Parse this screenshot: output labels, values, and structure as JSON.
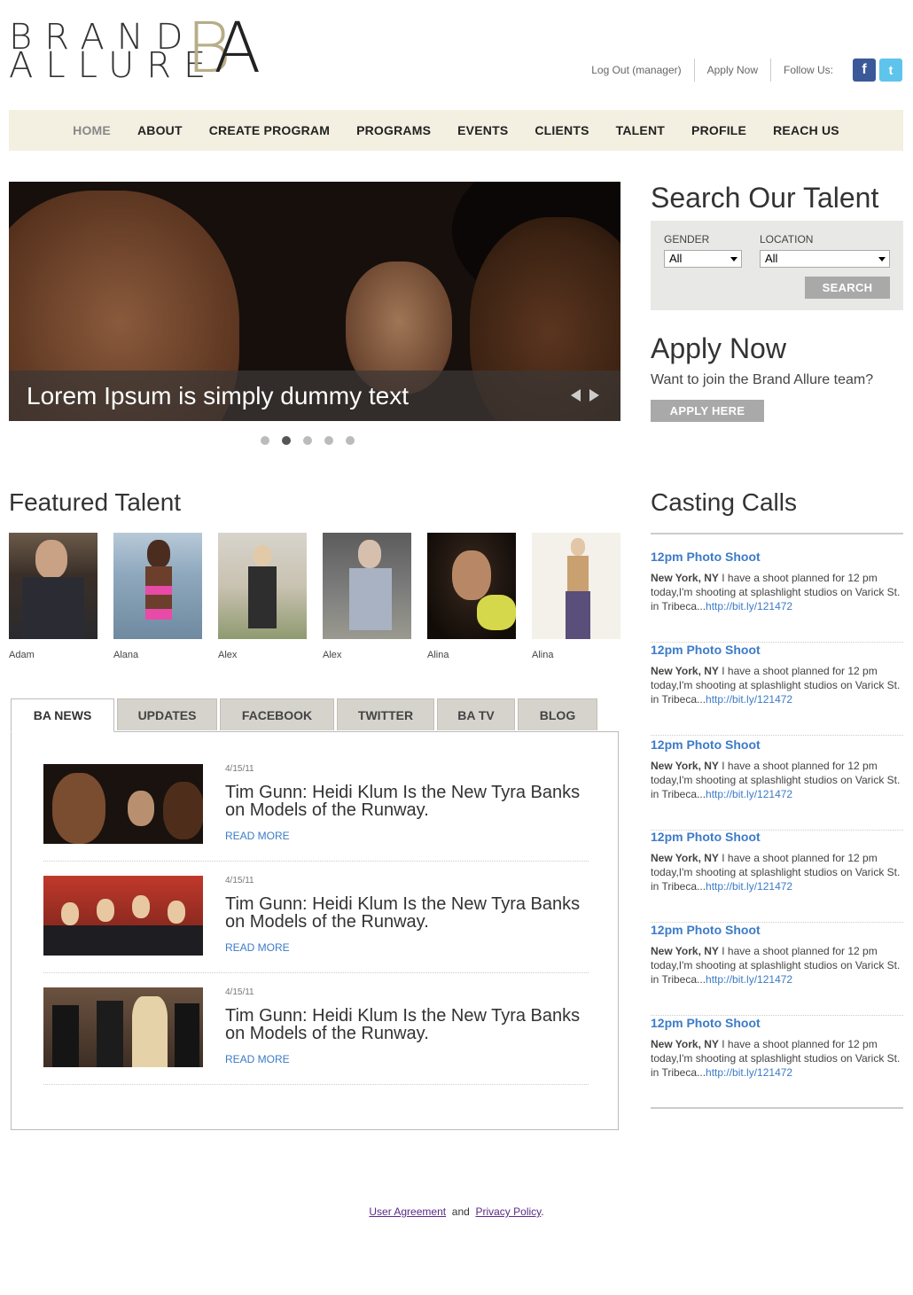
{
  "brand": {
    "line1": "BRAND",
    "line2": "ALLURE",
    "mono_b": "B",
    "mono_a": "A"
  },
  "toplinks": {
    "logout": "Log Out (manager)",
    "apply": "Apply Now",
    "follow": "Follow Us:",
    "facebook_icon": "f",
    "twitter_icon": "t"
  },
  "nav": [
    "HOME",
    "ABOUT",
    "CREATE PROGRAM",
    "PROGRAMS",
    "EVENTS",
    "CLIENTS",
    "TALENT",
    "PROFILE",
    "REACH US"
  ],
  "slider": {
    "caption": "Lorem Ipsum is simply dummy text",
    "active_dot": 1,
    "dot_count": 5
  },
  "search": {
    "title": "Search Our Talent",
    "gender_label": "GENDER",
    "gender_value": "All",
    "location_label": "LOCATION",
    "location_value": "All",
    "button": "SEARCH"
  },
  "apply": {
    "title": "Apply Now",
    "subtitle": "Want to join the Brand Allure team?",
    "button": "APPLY HERE"
  },
  "featured": {
    "title": "Featured Talent",
    "people": [
      "Adam",
      "Alana",
      "Alex",
      "Alex",
      "Alina",
      "Alina"
    ]
  },
  "tabs": [
    "BA NEWS",
    "UPDATES",
    "FACEBOOK",
    "TWITTER",
    "BA TV",
    "BLOG"
  ],
  "news": [
    {
      "date": "4/15/11",
      "headline": "Tim Gunn: Heidi Klum Is the New Tyra Banks on Models of the Runway.",
      "more": "READ MORE"
    },
    {
      "date": "4/15/11",
      "headline": "Tim Gunn: Heidi Klum Is the New Tyra Banks on Models of the Runway.",
      "more": "READ MORE"
    },
    {
      "date": "4/15/11",
      "headline": "Tim Gunn: Heidi Klum Is the New Tyra Banks on Models of the Runway.",
      "more": "READ MORE"
    }
  ],
  "casting": {
    "title": "Casting Calls",
    "items": [
      {
        "title": "12pm Photo Shoot",
        "location": "New York, NY",
        "text": " I have a shoot planned for 12 pm today,I'm shooting at splashlight studios on Varick St. in Tribeca...",
        "url": "http://bit.ly/121472"
      },
      {
        "title": "12pm Photo Shoot",
        "location": "New York, NY",
        "text": " I have a shoot planned for 12 pm today,I'm shooting at splashlight studios on Varick St. in Tribeca...",
        "url": "http://bit.ly/121472"
      },
      {
        "title": "12pm Photo Shoot",
        "location": "New York, NY",
        "text": " I have a shoot planned for 12 pm today,I'm shooting at splashlight studios on Varick St. in Tribeca...",
        "url": "http://bit.ly/121472"
      },
      {
        "title": "12pm Photo Shoot",
        "location": "New York, NY",
        "text": " I have a shoot planned for 12 pm today,I'm shooting at splashlight studios on Varick St. in Tribeca...",
        "url": "http://bit.ly/121472"
      },
      {
        "title": "12pm Photo Shoot",
        "location": "New York, NY",
        "text": " I have a shoot planned for 12 pm today,I'm shooting at splashlight studios on Varick St. in Tribeca...",
        "url": "http://bit.ly/121472"
      },
      {
        "title": "12pm Photo Shoot",
        "location": "New York, NY",
        "text": " I have a shoot planned for 12 pm today,I'm shooting at splashlight studios on Varick St. in Tribeca...",
        "url": "http://bit.ly/121472"
      }
    ]
  },
  "footer": {
    "agreement": "User Agreement",
    "and": "and",
    "privacy": "Privacy Policy",
    "dot": "."
  },
  "colors": {
    "nav_bg": "#f3efe1",
    "link_blue": "#3c7bc8",
    "gold": "#b7ad87",
    "button_grey": "#a9a9a9"
  }
}
